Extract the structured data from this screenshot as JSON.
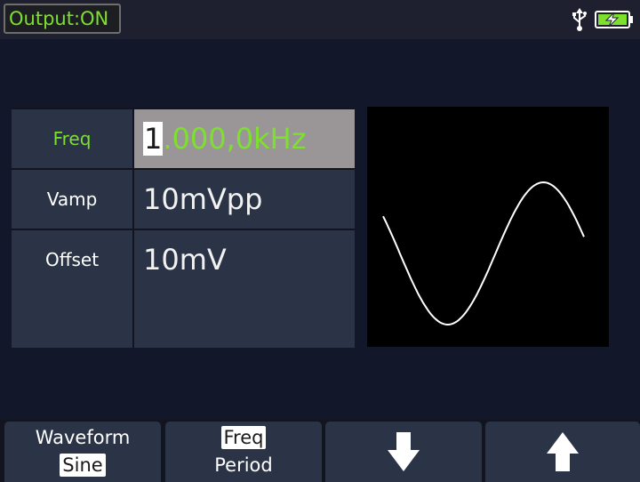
{
  "status_bar": {
    "output_label": "Output:ON",
    "icons": [
      "usb-icon",
      "battery-charging-icon"
    ],
    "output_color": "#7ee02e"
  },
  "parameters": [
    {
      "label": "Freq",
      "value_cursor": "1",
      "value_rest": ".000,0kHz",
      "selected": true
    },
    {
      "label": "Vamp",
      "value": "10mVpp",
      "selected": false
    },
    {
      "label": "Offset",
      "value": "10mV",
      "selected": false
    },
    {
      "label": "",
      "value": "",
      "selected": false
    }
  ],
  "preview": {
    "waveform": "sine"
  },
  "softkeys": [
    {
      "top_label": "Waveform",
      "bottom_label": "Sine",
      "selected": "bottom"
    },
    {
      "top_label": "Freq",
      "bottom_label": "Period",
      "selected": "top"
    },
    {
      "icon": "arrow-down-icon"
    },
    {
      "icon": "arrow-up-icon"
    }
  ],
  "colors": {
    "accent_green": "#7ee02e",
    "panel": "#2b3446",
    "selected_field": "#9a9698",
    "background": "#13172a"
  }
}
